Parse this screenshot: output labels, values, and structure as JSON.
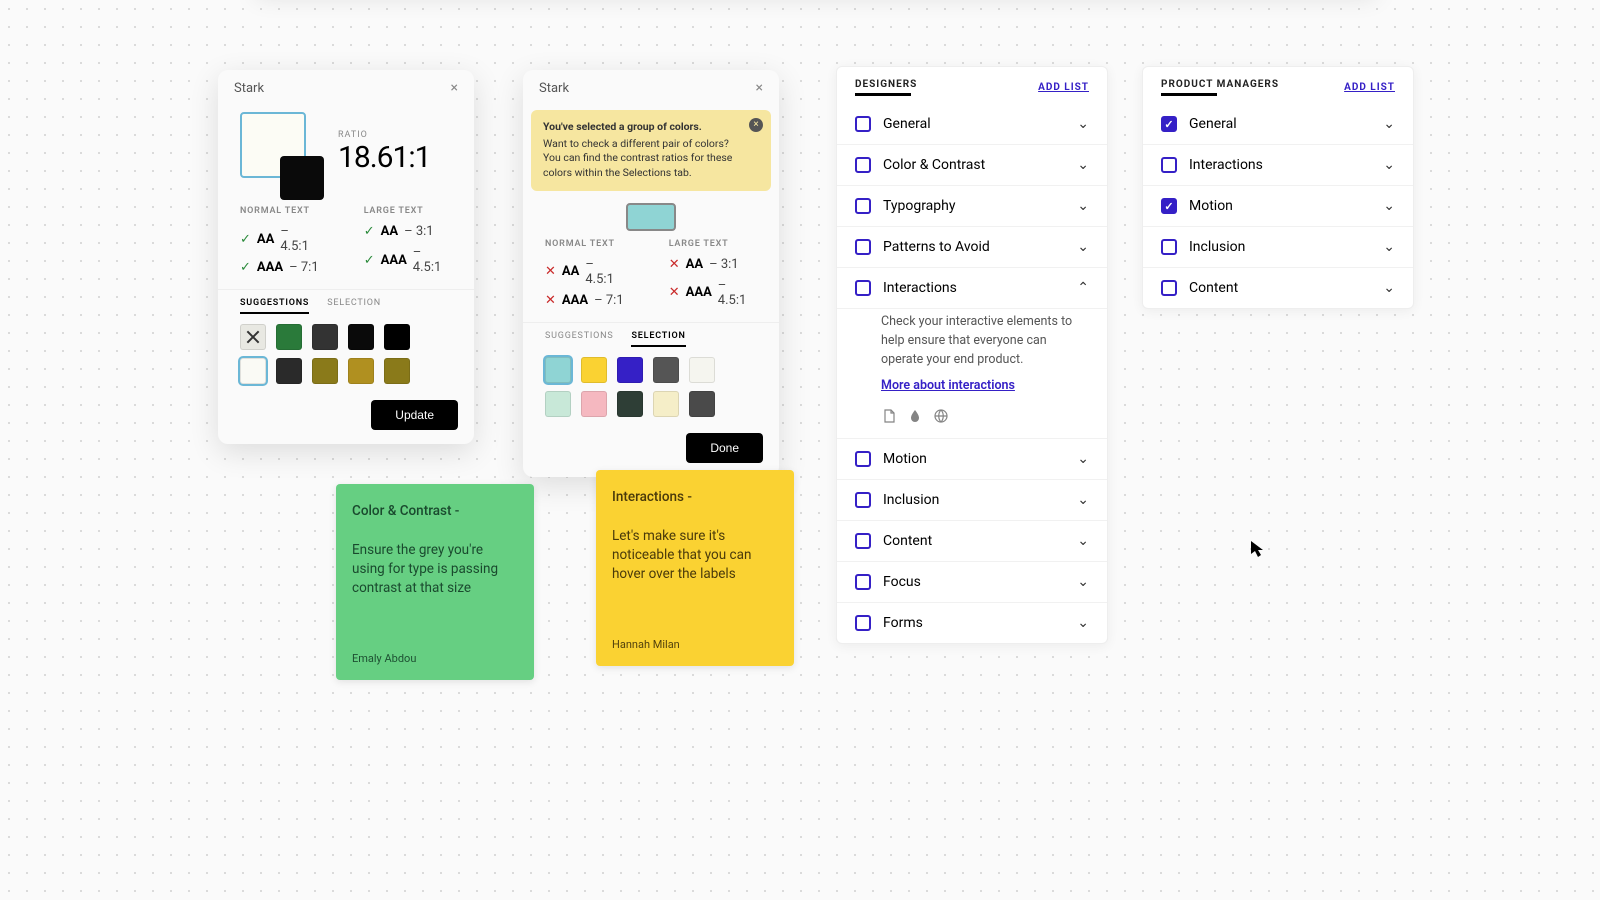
{
  "panel1": {
    "title": "Stark",
    "ratio_label": "RATIO",
    "ratio_value": "18.61:1",
    "columns": {
      "normal_head": "NORMAL TEXT",
      "large_head": "LARGE TEXT",
      "normal": [
        {
          "pass": true,
          "level": "AA",
          "ratio": "4.5:1"
        },
        {
          "pass": true,
          "level": "AAA",
          "ratio": "7:1"
        }
      ],
      "large": [
        {
          "pass": true,
          "level": "AA",
          "ratio": "3:1"
        },
        {
          "pass": true,
          "level": "AAA",
          "ratio": "4.5:1"
        }
      ]
    },
    "tabs": {
      "suggestions": "SUGGESTIONS",
      "selection": "SELECTION",
      "active": "suggestions"
    },
    "swatches": {
      "row1": [
        "#e8e8e2",
        "#2a7a3a",
        "#333333",
        "#0a0a0a",
        "#000000"
      ],
      "row2": [
        "#fafaf5",
        "#2a2a2a",
        "#8a7a1a",
        "#b09020",
        "#8a7a1a"
      ],
      "selected_r1": 0,
      "selected_r2": 0
    },
    "button": "Update"
  },
  "panel2": {
    "title": "Stark",
    "notice_title": "You've selected a group of colors.",
    "notice_body": "Want to check a different pair of colors? You can find the contrast ratios for these colors within the Selections tab.",
    "columns": {
      "normal_head": "NORMAL TEXT",
      "large_head": "LARGE TEXT",
      "normal": [
        {
          "pass": false,
          "level": "AA",
          "ratio": "4.5:1"
        },
        {
          "pass": false,
          "level": "AAA",
          "ratio": "7:1"
        }
      ],
      "large": [
        {
          "pass": false,
          "level": "AA",
          "ratio": "3:1"
        },
        {
          "pass": false,
          "level": "AAA",
          "ratio": "4.5:1"
        }
      ]
    },
    "tabs": {
      "suggestions": "SUGGESTIONS",
      "selection": "SELECTION",
      "active": "selection"
    },
    "swatches": {
      "row1": [
        "#8fd4d4",
        "#fad232",
        "#3520c6",
        "#555555",
        "#f5f5ef"
      ],
      "row2": [
        "#c8e8d8",
        "#f5b8c0",
        "#2e3e36",
        "#f5eec8",
        "#4a4a4a"
      ],
      "selected": 0
    },
    "button": "Done"
  },
  "checklist1": {
    "title": "DESIGNERS",
    "add": "ADD LIST",
    "items": [
      {
        "label": "General",
        "checked": false,
        "open": false
      },
      {
        "label": "Color & Contrast",
        "checked": false,
        "open": false
      },
      {
        "label": "Typography",
        "checked": false,
        "open": false
      },
      {
        "label": "Patterns to Avoid",
        "checked": false,
        "open": false
      },
      {
        "label": "Interactions",
        "checked": false,
        "open": true,
        "body": "Check your interactive elements to help ensure that everyone can operate your end product.",
        "link": "More about interactions"
      },
      {
        "label": "Motion",
        "checked": false,
        "open": false
      },
      {
        "label": "Inclusion",
        "checked": false,
        "open": false
      },
      {
        "label": "Content",
        "checked": false,
        "open": false
      },
      {
        "label": "Focus",
        "checked": false,
        "open": false
      },
      {
        "label": "Forms",
        "checked": false,
        "open": false
      }
    ]
  },
  "checklist2": {
    "title": "PRODUCT MANAGERS",
    "add": "ADD LIST",
    "items": [
      {
        "label": "General",
        "checked": true,
        "open": false
      },
      {
        "label": "Interactions",
        "checked": false,
        "open": false
      },
      {
        "label": "Motion",
        "checked": true,
        "open": false
      },
      {
        "label": "Inclusion",
        "checked": false,
        "open": false
      },
      {
        "label": "Content",
        "checked": false,
        "open": false
      }
    ]
  },
  "sticky1": {
    "title": "Color & Contrast -",
    "body": "Ensure the grey you're using for type is passing contrast at that size",
    "author": "Emaly Abdou"
  },
  "sticky2": {
    "title": "Interactions -",
    "body": "Let's make sure it's noticeable that you can hover over the labels",
    "author": "Hannah Milan"
  }
}
